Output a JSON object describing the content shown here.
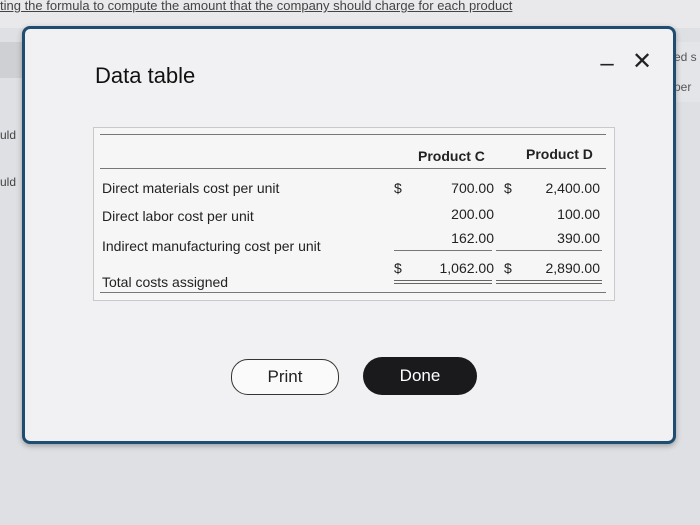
{
  "background": {
    "header_text": "ting the formula to compute the amount that the company should charge for each product",
    "left_fragments": [
      "uld",
      "uld"
    ],
    "right_fragments": [
      "ed s",
      "per"
    ]
  },
  "dialog": {
    "title": "Data table",
    "minimize_symbol": "–",
    "close_symbol": "✕",
    "table": {
      "headers": [
        "Product C",
        "Product D"
      ],
      "rows": [
        {
          "label": "Direct materials cost per unit",
          "c_prefix": "$",
          "c": "700.00",
          "d_prefix": "$",
          "d": "2,400.00"
        },
        {
          "label": "Direct labor cost per unit",
          "c_prefix": "",
          "c": "200.00",
          "d_prefix": "",
          "d": "100.00"
        },
        {
          "label": "Indirect manufacturing cost per unit",
          "c_prefix": "",
          "c": "162.00",
          "d_prefix": "",
          "d": "390.00"
        },
        {
          "label": "Total costs assigned",
          "c_prefix": "$",
          "c": "1,062.00",
          "d_prefix": "$",
          "d": "2,890.00"
        }
      ]
    },
    "buttons": {
      "print": "Print",
      "done": "Done"
    }
  }
}
